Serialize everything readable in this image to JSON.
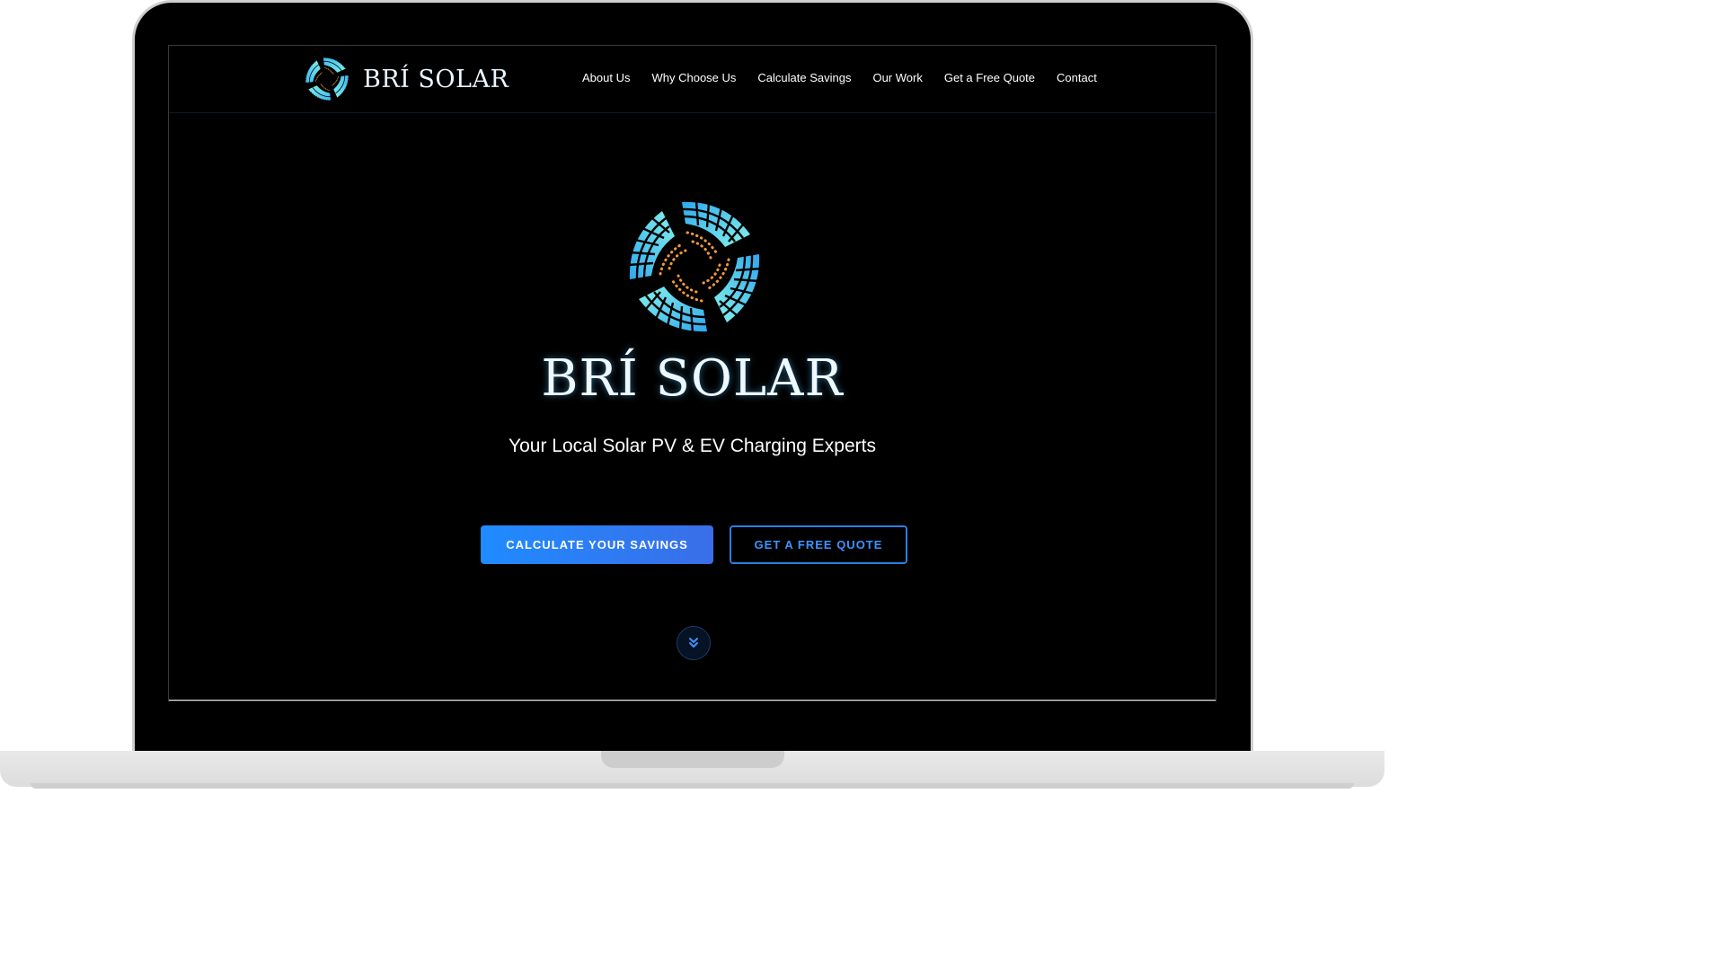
{
  "brand": {
    "name": "BRÍ SOLAR"
  },
  "nav": {
    "items": [
      {
        "label": "About Us"
      },
      {
        "label": "Why Choose Us"
      },
      {
        "label": "Calculate Savings"
      },
      {
        "label": "Our Work"
      },
      {
        "label": "Get a Free Quote"
      },
      {
        "label": "Contact"
      }
    ]
  },
  "hero": {
    "title": "BRÍ SOLAR",
    "subtitle": "Your Local Solar PV & EV Charging Experts",
    "primary_cta": "CALCULATE YOUR SAVINGS",
    "secondary_cta": "GET A FREE QUOTE",
    "scroll_icon": "chevrons-down-icon"
  },
  "colors": {
    "background": "#000000",
    "accent_blue": "#1f8bff",
    "accent_cyan": "#4fd4f5",
    "accent_orange": "#f29a3a"
  }
}
